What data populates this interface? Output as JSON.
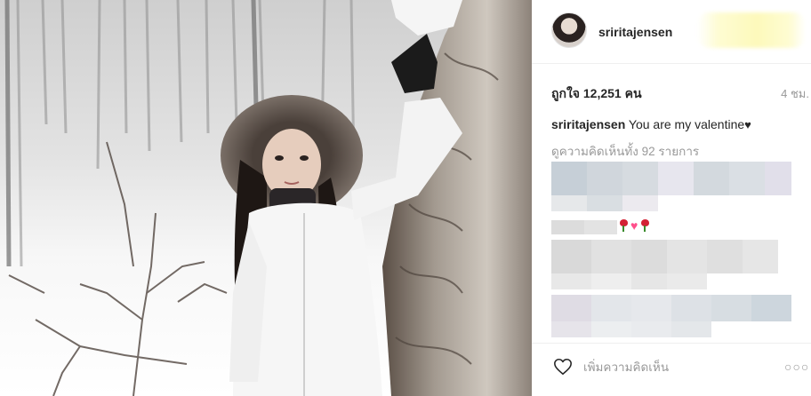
{
  "post": {
    "username": "sriritajensen",
    "likes": "ถูกใจ 12,251 คน",
    "timestamp": "4 ชม.",
    "caption_user": "sriritajensen",
    "caption_text": "You are my valentine",
    "caption_heart": "♥",
    "view_all_comments": "ดูความคิดเห็นทั้ง 92 รายการ",
    "comment_placeholder": "เพิ่มความคิดเห็น",
    "more_label": "○○○"
  },
  "icons": {
    "like": "heart-outline-icon",
    "more": "more-options-icon",
    "emoji": [
      "rose-icon",
      "pink-heart-icon",
      "rose-icon"
    ]
  },
  "colors": {
    "text": "#262626",
    "muted": "#999999",
    "divider": "#efefef",
    "pink": "#ff4f8b"
  }
}
